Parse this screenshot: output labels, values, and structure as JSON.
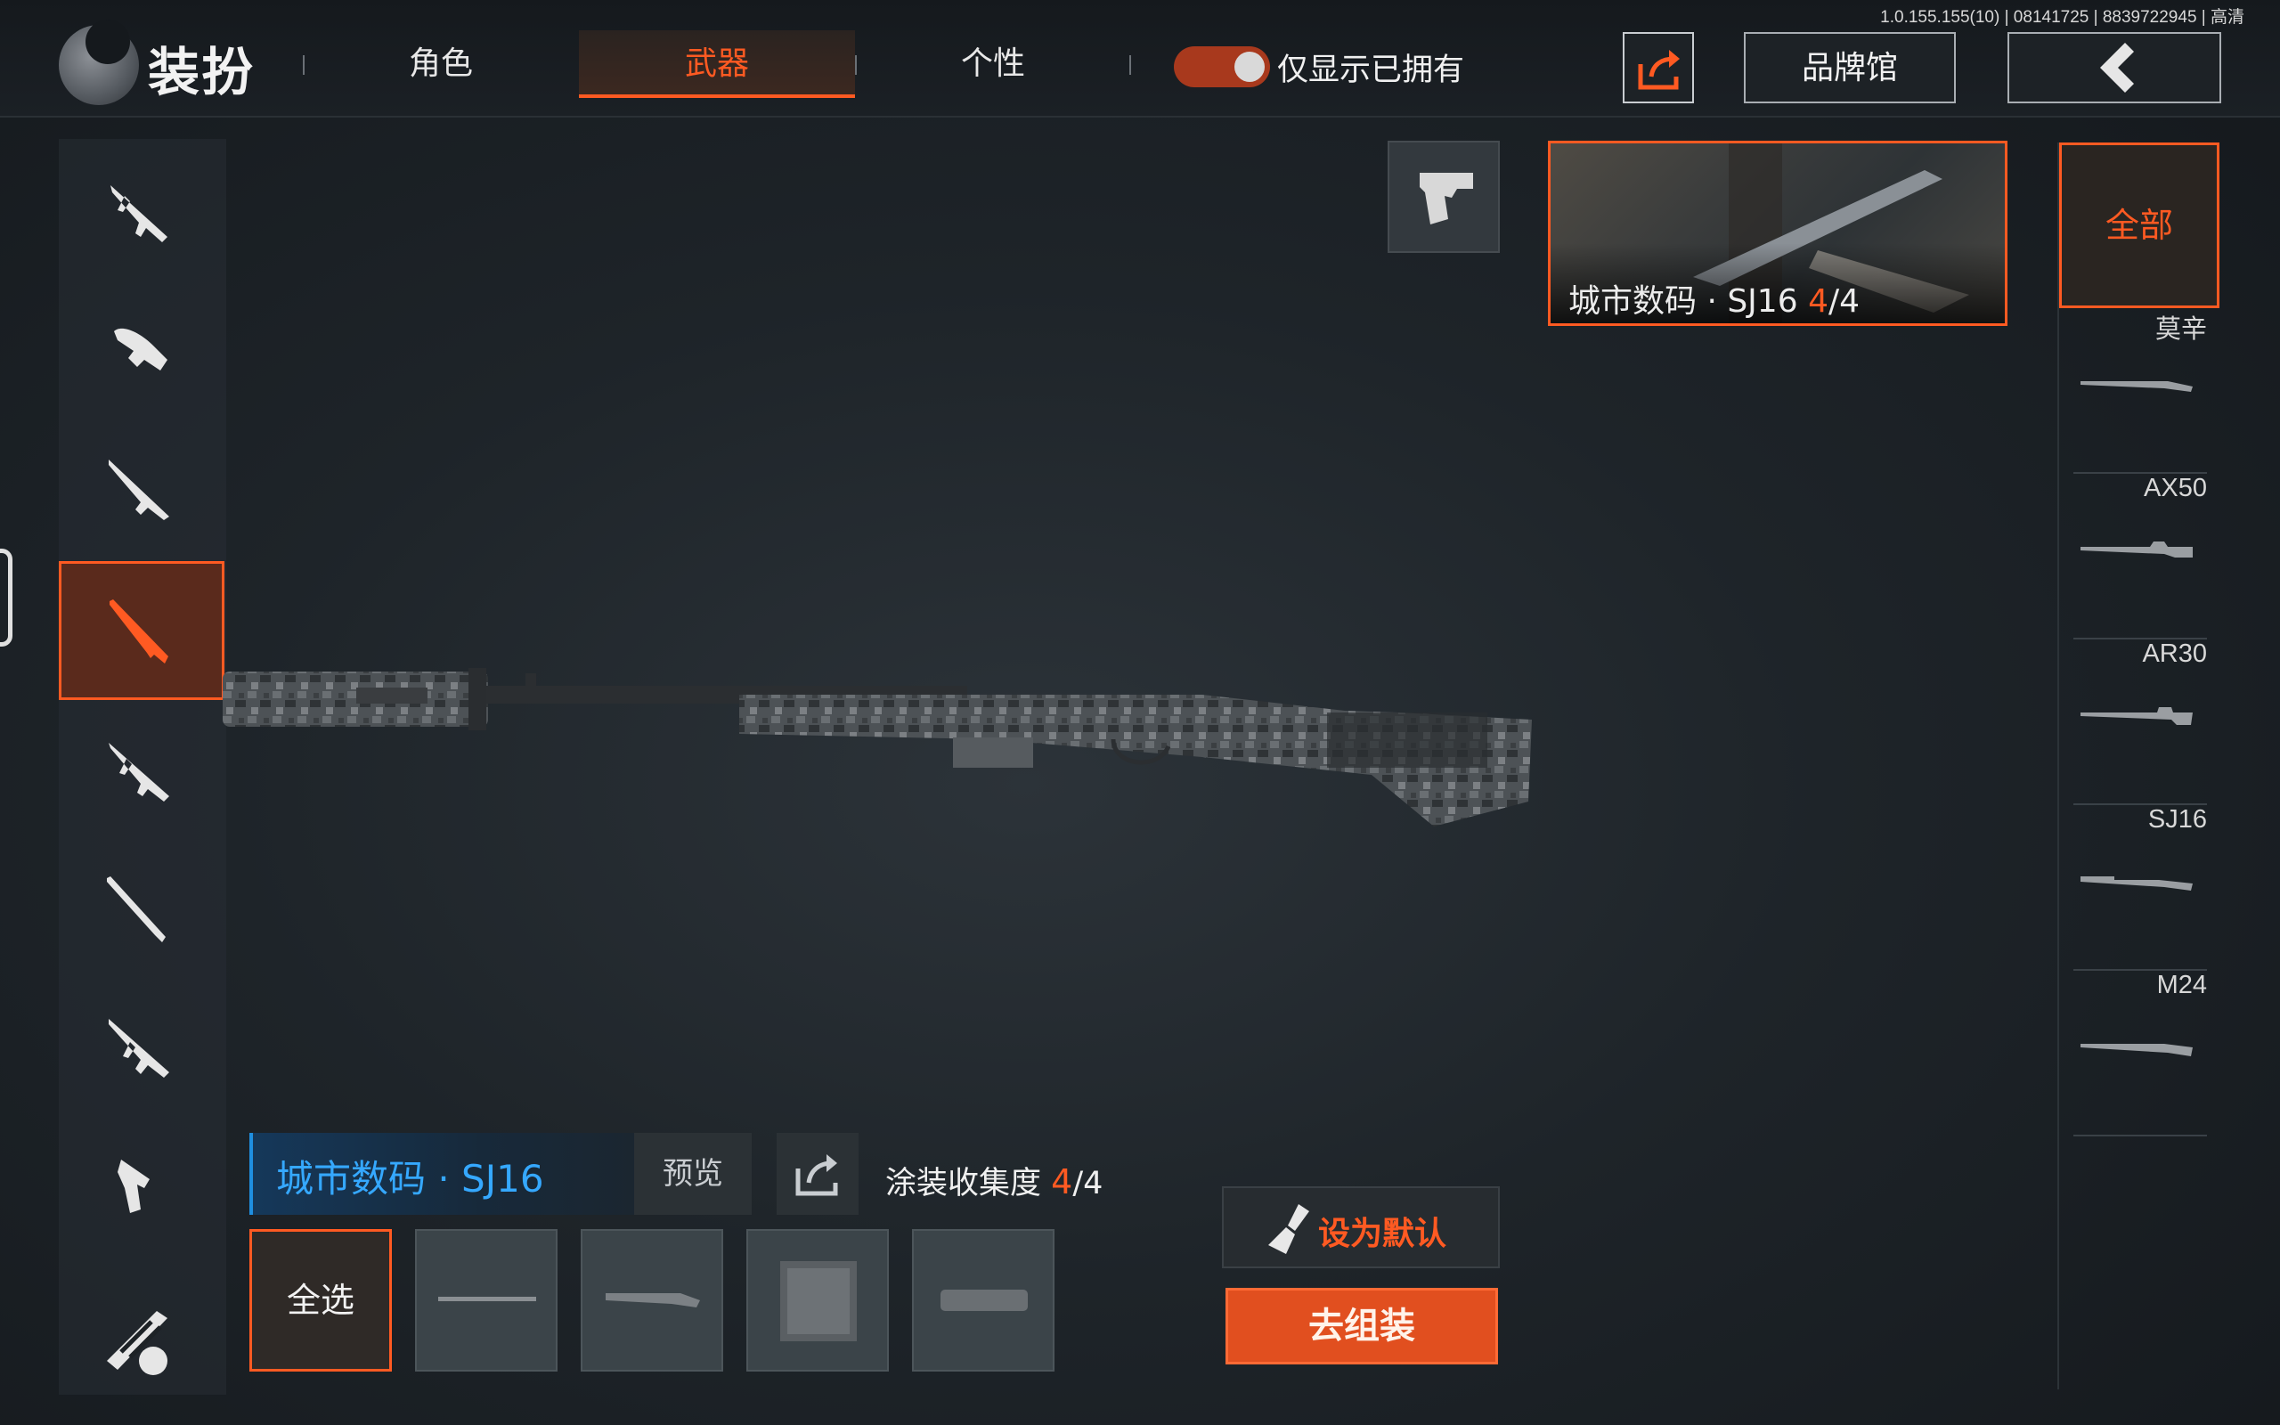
{
  "version_info": "1.0.155.155(10) | 08141725 | 8839722945 | 高清",
  "header": {
    "title": "装扮",
    "tabs": [
      {
        "label": "角色",
        "active": false
      },
      {
        "label": "武器",
        "active": true
      },
      {
        "label": "个性",
        "active": false
      }
    ],
    "toggle_label": "仅显示已拥有",
    "toggle_on": true,
    "brand_label": "品牌馆"
  },
  "left_categories": [
    {
      "icon": "assault-rifle-icon",
      "active": false
    },
    {
      "icon": "submachine-gun-icon",
      "active": false
    },
    {
      "icon": "marksman-rifle-icon",
      "active": false
    },
    {
      "icon": "sniper-rifle-icon",
      "active": true
    },
    {
      "icon": "assault-rifle-alt-icon",
      "active": false
    },
    {
      "icon": "shotgun-icon",
      "active": false
    },
    {
      "icon": "light-machine-gun-icon",
      "active": false
    },
    {
      "icon": "pistol-icon",
      "active": false
    },
    {
      "icon": "special-weapon-icon",
      "active": false
    }
  ],
  "preview_card": {
    "name": "城市数码 · SJ16",
    "owned": "4",
    "total": "/4"
  },
  "filter": {
    "all_label": "全部",
    "weapons": [
      "莫辛",
      "AX50",
      "AR30",
      "SJ16",
      "M24"
    ]
  },
  "skin": {
    "name": "城市数码 · SJ16",
    "preview_label": "预览",
    "collection_label": "涂装收集度",
    "collected": "4",
    "collection_total": "/4",
    "select_all_label": "全选"
  },
  "actions": {
    "set_default_label": "设为默认",
    "assemble_label": "去组装"
  },
  "colors": {
    "accent": "#ff5a22",
    "skin_name_blue": "#35a8ff"
  }
}
